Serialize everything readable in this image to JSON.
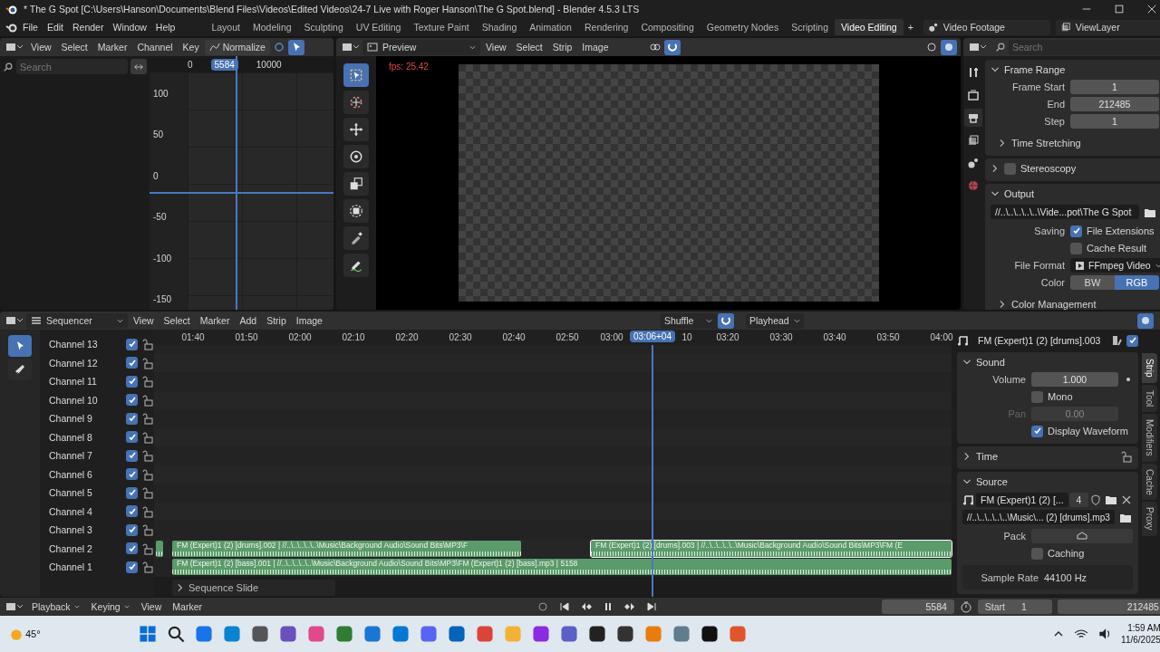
{
  "window": {
    "title": "* The G Spot [C:\\Users\\Hanson\\Documents\\Blend Files\\Videos\\Edited Videos\\24-7 Live with Roger Hanson\\The G Spot.blend] - Blender 4.5.3 LTS"
  },
  "menu": [
    "File",
    "Edit",
    "Render",
    "Window",
    "Help"
  ],
  "workspaces": [
    {
      "label": "Layout",
      "selected": false
    },
    {
      "label": "Modeling",
      "selected": false
    },
    {
      "label": "Sculpting",
      "selected": false
    },
    {
      "label": "UV Editing",
      "selected": false
    },
    {
      "label": "Texture Paint",
      "selected": false
    },
    {
      "label": "Shading",
      "selected": false
    },
    {
      "label": "Animation",
      "selected": false
    },
    {
      "label": "Rendering",
      "selected": false
    },
    {
      "label": "Compositing",
      "selected": false
    },
    {
      "label": "Geometry Nodes",
      "selected": false
    },
    {
      "label": "Scripting",
      "selected": false
    },
    {
      "label": "Video Editing",
      "selected": true
    }
  ],
  "add_workspace": "+",
  "scene": "Video Footage",
  "view_layer": "ViewLayer",
  "graph_editor": {
    "menu": [
      "View",
      "Select",
      "Marker",
      "Channel",
      "Key"
    ],
    "normalize": {
      "label": "Normalize",
      "on": false
    },
    "search": {
      "placeholder": "Search"
    },
    "frame_ruler": [
      {
        "label": "0",
        "current": false
      },
      {
        "label": "5584",
        "current": true
      },
      {
        "label": "10000",
        "current": false
      }
    ],
    "value_ticks": [
      "100",
      "50",
      "0",
      "-50",
      "-100",
      "-150"
    ]
  },
  "preview": {
    "mode": "Preview",
    "menu": [
      "View",
      "Select",
      "Strip",
      "Image"
    ],
    "fps": "fps: 25.42",
    "tools": [
      {
        "kind": "select-box",
        "selected": true
      },
      {
        "kind": "cursor",
        "selected": false
      },
      {
        "kind": "move",
        "selected": false
      },
      {
        "kind": "rotate",
        "selected": false
      },
      {
        "kind": "scale",
        "selected": false
      },
      {
        "kind": "transform",
        "selected": false
      },
      {
        "kind": "sample",
        "selected": false
      },
      {
        "kind": "annotate",
        "selected": false
      }
    ]
  },
  "properties": {
    "search": {
      "placeholder": "Search"
    },
    "tabs": [
      {
        "kind": "tool",
        "selected": false
      },
      {
        "kind": "render",
        "selected": false
      },
      {
        "kind": "output",
        "selected": true
      },
      {
        "kind": "view-layer",
        "selected": false
      },
      {
        "kind": "scene",
        "selected": false
      },
      {
        "kind": "world",
        "selected": false
      }
    ],
    "frame_range": {
      "title": "Frame Range",
      "expanded": true,
      "fields": [
        {
          "label": "Frame Start",
          "value": "1"
        },
        {
          "label": "End",
          "value": "212485"
        },
        {
          "label": "Step",
          "value": "1"
        }
      ]
    },
    "time_stretching": {
      "title": "Time Stretching",
      "expanded": false
    },
    "stereoscopy": {
      "title": "Stereoscopy",
      "expanded": false,
      "checked": false
    },
    "output": {
      "title": "Output",
      "expanded": true,
      "path": "//..\\..\\..\\..\\..\\Vide...pot\\The G Spot",
      "saving_label": "Saving",
      "file_extensions": {
        "label": "File Extensions",
        "checked": true
      },
      "cache_result": {
        "label": "Cache Result",
        "checked": false
      },
      "file_format_label": "File Format",
      "file_format": "FFmpeg Video",
      "color_label": "Color",
      "color_modes": [
        {
          "label": "BW",
          "selected": false
        },
        {
          "label": "RGB",
          "selected": true
        }
      ]
    },
    "color_management": {
      "title": "Color Management",
      "expanded": false
    }
  },
  "sequencer": {
    "editor": "Sequencer",
    "menu": [
      "View",
      "Select",
      "Marker",
      "Add",
      "Strip",
      "Image"
    ],
    "overlap_mode": "Shuffle",
    "snap_on": true,
    "pivot": "Playhead",
    "tools": [
      {
        "kind": "select",
        "selected": true
      },
      {
        "kind": "blade",
        "selected": false
      }
    ],
    "ruler": [
      "01:40",
      "01:50",
      "02:00",
      "02:10",
      "02:20",
      "02:30",
      "02:40",
      "02:50",
      "03:00",
      "10",
      "03:20",
      "03:30",
      "03:40",
      "03:50",
      "04:00"
    ],
    "playhead": "03:06+04",
    "channels": [
      {
        "name": "Channel 13",
        "checked": true
      },
      {
        "name": "Channel 12",
        "checked": true
      },
      {
        "name": "Channel 11",
        "checked": true
      },
      {
        "name": "Channel 10",
        "checked": true
      },
      {
        "name": "Channel 9",
        "checked": true
      },
      {
        "name": "Channel 8",
        "checked": true
      },
      {
        "name": "Channel 7",
        "checked": true
      },
      {
        "name": "Channel 6",
        "checked": true
      },
      {
        "name": "Channel 5",
        "checked": true
      },
      {
        "name": "Channel 4",
        "checked": true
      },
      {
        "name": "Channel 3",
        "checked": true
      },
      {
        "name": "Channel 2",
        "checked": true,
        "strips": [
          {
            "selected": false
          },
          {
            "label": "FM (Expert)1 (2) [drums].002 | //..\\..\\..\\..\\..\\Music\\Background Audio\\Sound Bits\\MP3\\F",
            "selected": false
          },
          {
            "label": "FM (Expert)1 (2) [drums].003 | //..\\..\\..\\..\\..\\Music\\Background Audio\\Sound Bits\\MP3\\FM (E",
            "selected": true
          }
        ]
      },
      {
        "name": "Channel 1",
        "checked": true,
        "strips": [
          {
            "label": "FM (Expert)1 (2) [bass].001 | //..\\..\\..\\..\\..\\Music\\Background Audio\\Sound Bits\\MP3\\FM (Expert)1 (2) [bass].mp3 | 5158",
            "selected": false
          }
        ]
      }
    ],
    "sequence_slide": {
      "label": "Sequence Slide",
      "expanded": false
    }
  },
  "strip_panel": {
    "name": "FM (Expert)1 (2) [drums].003",
    "enabled": true,
    "tabs": [
      {
        "label": "Strip",
        "selected": true
      },
      {
        "label": "Tool",
        "selected": false
      },
      {
        "label": "Modifiers",
        "selected": false
      },
      {
        "label": "Cache",
        "selected": false
      },
      {
        "label": "Proxy",
        "selected": false
      }
    ],
    "sound": {
      "title": "Sound",
      "expanded": true,
      "volume": {
        "label": "Volume",
        "value": "1.000"
      },
      "mono": {
        "label": "Mono",
        "checked": false
      },
      "pan": {
        "label": "Pan",
        "value": "0.00",
        "disabled": true
      },
      "display_waveform": {
        "label": "Display Waveform",
        "checked": true
      }
    },
    "time": {
      "title": "Time",
      "expanded": false
    },
    "source": {
      "title": "Source",
      "expanded": true,
      "sound": "FM (Expert)1 (2) [...",
      "users": "4",
      "path": "//..\\..\\..\\..\\..\\Music\\... (2) [drums].mp3",
      "pack_label": "Pack",
      "caching": {
        "label": "Caching",
        "checked": false
      },
      "sample_rate_label": "Sample Rate",
      "sample_rate": "44100 Hz"
    }
  },
  "timeline": {
    "menu": [
      {
        "label": "Playback",
        "dropdown": true
      },
      {
        "label": "Keying",
        "dropdown": true
      },
      {
        "label": "View",
        "dropdown": false
      },
      {
        "label": "Marker",
        "dropdown": false
      }
    ],
    "playing": true,
    "current_frame": "5584",
    "start_label": "Start",
    "start": "1",
    "end": "212485"
  },
  "taskbar": {
    "weather": "45°",
    "time": "1:59 AM",
    "date": "11/6/2025"
  }
}
